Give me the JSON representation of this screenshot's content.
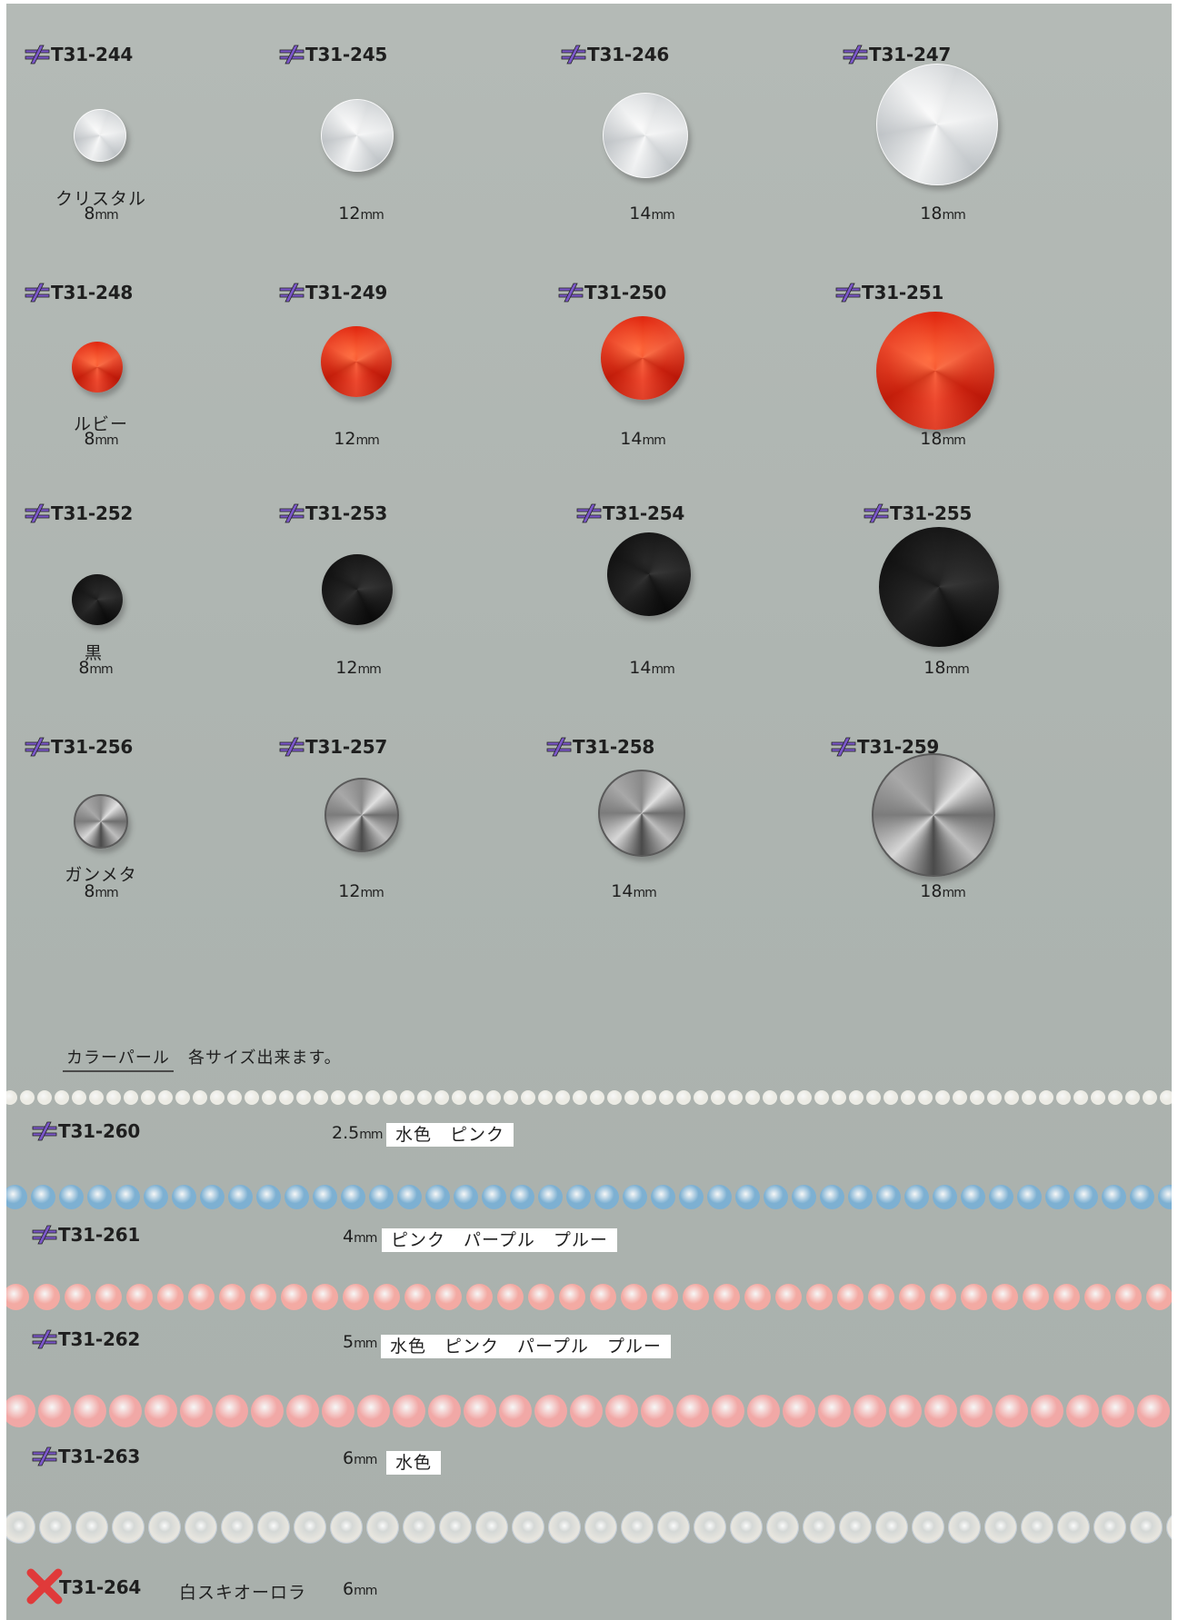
{
  "rivoli_rows": [
    {
      "color_name": "クリスタル",
      "finish": "crystal",
      "items": [
        {
          "code": "T31-244",
          "size_value": "8",
          "size_unit": "mm"
        },
        {
          "code": "T31-245",
          "size_value": "12",
          "size_unit": "mm"
        },
        {
          "code": "T31-246",
          "size_value": "14",
          "size_unit": "mm"
        },
        {
          "code": "T31-247",
          "size_value": "18",
          "size_unit": "mm"
        }
      ]
    },
    {
      "color_name": "ルビー",
      "finish": "ruby",
      "items": [
        {
          "code": "T31-248",
          "size_value": "8",
          "size_unit": "mm"
        },
        {
          "code": "T31-249",
          "size_value": "12",
          "size_unit": "mm"
        },
        {
          "code": "T31-250",
          "size_value": "14",
          "size_unit": "mm"
        },
        {
          "code": "T31-251",
          "size_value": "18",
          "size_unit": "mm"
        }
      ]
    },
    {
      "color_name": "黒",
      "finish": "black",
      "items": [
        {
          "code": "T31-252",
          "size_value": "8",
          "size_unit": "mm"
        },
        {
          "code": "T31-253",
          "size_value": "12",
          "size_unit": "mm"
        },
        {
          "code": "T31-254",
          "size_value": "14",
          "size_unit": "mm"
        },
        {
          "code": "T31-255",
          "size_value": "18",
          "size_unit": "mm"
        }
      ]
    },
    {
      "color_name": "ガンメタ",
      "finish": "gunmetal",
      "items": [
        {
          "code": "T31-256",
          "size_value": "8",
          "size_unit": "mm"
        },
        {
          "code": "T31-257",
          "size_value": "12",
          "size_unit": "mm"
        },
        {
          "code": "T31-258",
          "size_value": "14",
          "size_unit": "mm"
        },
        {
          "code": "T31-259",
          "size_value": "18",
          "size_unit": "mm"
        }
      ]
    }
  ],
  "pearl_section": {
    "title": "カラーパール",
    "note": "各サイズ出来ます。"
  },
  "pearls": [
    {
      "code": "T31-260",
      "size_value": "2.5",
      "size_unit": "mm",
      "colors": "水色　ピンク",
      "strand_color": "#ecebe4"
    },
    {
      "code": "T31-261",
      "size_value": "4",
      "size_unit": "mm",
      "colors": "ピンク　パープル　プルー",
      "strand_color": "#7db0d2"
    },
    {
      "code": "T31-262",
      "size_value": "5",
      "size_unit": "mm",
      "colors": "水色　ピンク　パープル　プルー",
      "strand_color": "#f3aaa3"
    },
    {
      "code": "T31-263",
      "size_value": "6",
      "size_unit": "mm",
      "colors": "水色",
      "strand_color": "#f1a8a6"
    }
  ],
  "aurora": {
    "code": "T31-264",
    "name": "白スキオーロラ",
    "size_value": "6",
    "size_unit": "mm",
    "strand_color": "#e8e6df",
    "discontinued_mark": "x-mark"
  },
  "colors": {
    "logo_purple": "#7b57c9",
    "x_mark_red": "#e03a3a"
  }
}
